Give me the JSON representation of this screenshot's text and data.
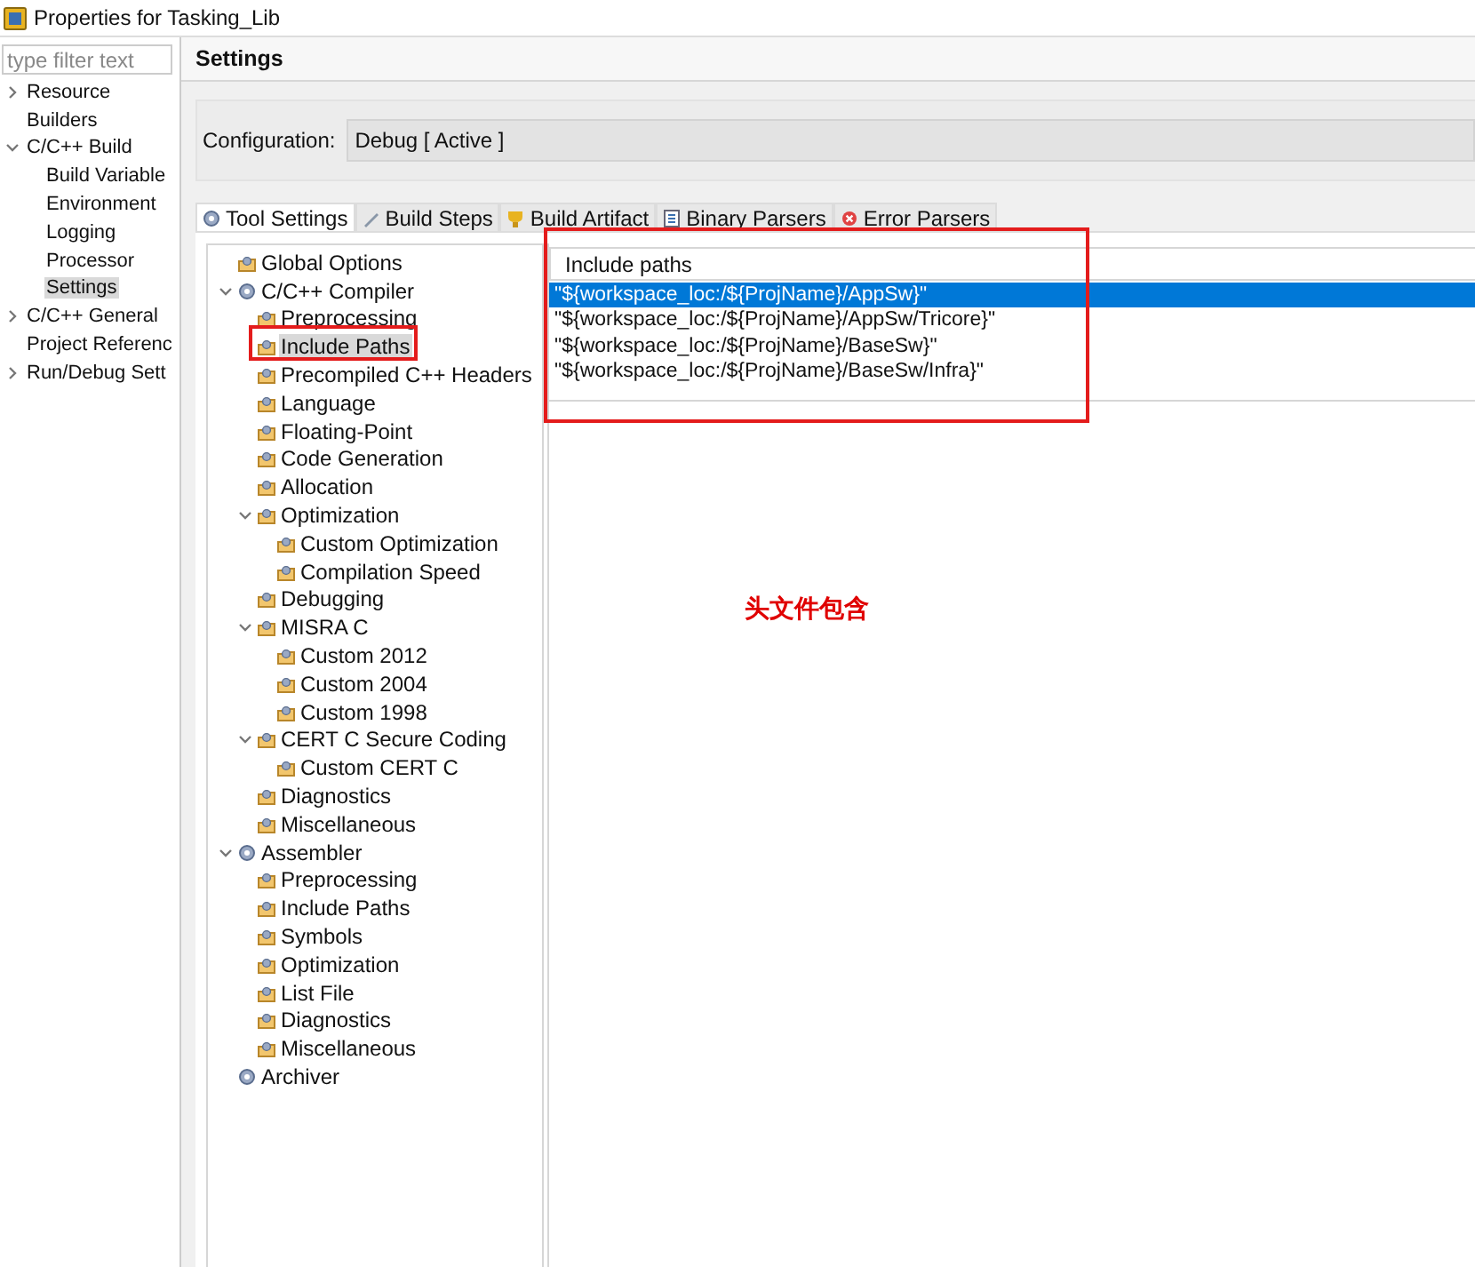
{
  "window": {
    "title": "Properties for Tasking_Lib"
  },
  "filter": {
    "placeholder": "type filter text"
  },
  "nav": [
    {
      "label": "Resource",
      "expanded": false,
      "selected": false
    },
    {
      "label": "Builders",
      "selected": false
    },
    {
      "label": "C/C++ Build",
      "expanded": true,
      "selected": false,
      "children": [
        {
          "label": "Build Variable",
          "selected": false
        },
        {
          "label": "Environment",
          "selected": false
        },
        {
          "label": "Logging",
          "selected": false
        },
        {
          "label": "Processor",
          "selected": false
        },
        {
          "label": "Settings",
          "selected": true
        }
      ]
    },
    {
      "label": "C/C++ General",
      "expanded": false,
      "selected": false
    },
    {
      "label": "Project Referenc",
      "selected": false
    },
    {
      "label": "Run/Debug Sett",
      "expanded": false,
      "selected": false
    }
  ],
  "page": {
    "title": "Settings"
  },
  "configuration": {
    "label": "Configuration:",
    "value": "Debug  [ Active ]"
  },
  "tabs": [
    {
      "label": "Tool Settings",
      "kind": "tool",
      "selected": true
    },
    {
      "label": "Build Steps",
      "kind": "steps",
      "selected": false
    },
    {
      "label": "Build Artifact",
      "kind": "artifact",
      "selected": false
    },
    {
      "label": "Binary Parsers",
      "kind": "binary",
      "selected": false
    },
    {
      "label": "Error Parsers",
      "kind": "error",
      "selected": false
    }
  ],
  "tool_tree": [
    {
      "label": "Global Options",
      "kind": "page",
      "selected": false
    },
    {
      "label": "C/C++ Compiler",
      "kind": "tool",
      "expanded": true,
      "selected": false,
      "children": [
        {
          "label": "Preprocessing",
          "kind": "page",
          "selected": false
        },
        {
          "label": "Include Paths",
          "kind": "page",
          "selected": true
        },
        {
          "label": "Precompiled C++ Headers",
          "kind": "page",
          "selected": false
        },
        {
          "label": "Language",
          "kind": "page",
          "selected": false
        },
        {
          "label": "Floating-Point",
          "kind": "page",
          "selected": false
        },
        {
          "label": "Code Generation",
          "kind": "page",
          "selected": false
        },
        {
          "label": "Allocation",
          "kind": "page",
          "selected": false
        },
        {
          "label": "Optimization",
          "kind": "page",
          "expanded": true,
          "selected": false,
          "children": [
            {
              "label": "Custom Optimization",
              "kind": "page",
              "selected": false
            },
            {
              "label": "Compilation Speed",
              "kind": "page",
              "selected": false
            }
          ]
        },
        {
          "label": "Debugging",
          "kind": "page",
          "selected": false
        },
        {
          "label": "MISRA C",
          "kind": "page",
          "expanded": true,
          "selected": false,
          "children": [
            {
              "label": "Custom 2012",
              "kind": "page",
              "selected": false
            },
            {
              "label": "Custom 2004",
              "kind": "page",
              "selected": false
            },
            {
              "label": "Custom 1998",
              "kind": "page",
              "selected": false
            }
          ]
        },
        {
          "label": "CERT C Secure Coding",
          "kind": "page",
          "expanded": true,
          "selected": false,
          "children": [
            {
              "label": "Custom CERT C",
              "kind": "page",
              "selected": false
            }
          ]
        },
        {
          "label": "Diagnostics",
          "kind": "page",
          "selected": false
        },
        {
          "label": "Miscellaneous",
          "kind": "page",
          "selected": false
        }
      ]
    },
    {
      "label": "Assembler",
      "kind": "tool",
      "expanded": true,
      "selected": false,
      "children": [
        {
          "label": "Preprocessing",
          "kind": "page",
          "selected": false
        },
        {
          "label": "Include Paths",
          "kind": "page",
          "selected": false
        },
        {
          "label": "Symbols",
          "kind": "page",
          "selected": false
        },
        {
          "label": "Optimization",
          "kind": "page",
          "selected": false
        },
        {
          "label": "List File",
          "kind": "page",
          "selected": false
        },
        {
          "label": "Diagnostics",
          "kind": "page",
          "selected": false
        },
        {
          "label": "Miscellaneous",
          "kind": "page",
          "selected": false
        }
      ]
    },
    {
      "label": "Archiver",
      "kind": "tool",
      "selected": false
    }
  ],
  "include_paths": {
    "header": "Include paths",
    "rows": [
      {
        "text": "\"${workspace_loc:/${ProjName}/AppSw}\"",
        "selected": true
      },
      {
        "text": "\"${workspace_loc:/${ProjName}/AppSw/Tricore}\"",
        "selected": false
      },
      {
        "text": "\"${workspace_loc:/${ProjName}/BaseSw}\"",
        "selected": false
      },
      {
        "text": "\"${workspace_loc:/${ProjName}/BaseSw/Infra}\"",
        "selected": false
      }
    ]
  },
  "annotation": {
    "text": "头文件包含"
  }
}
